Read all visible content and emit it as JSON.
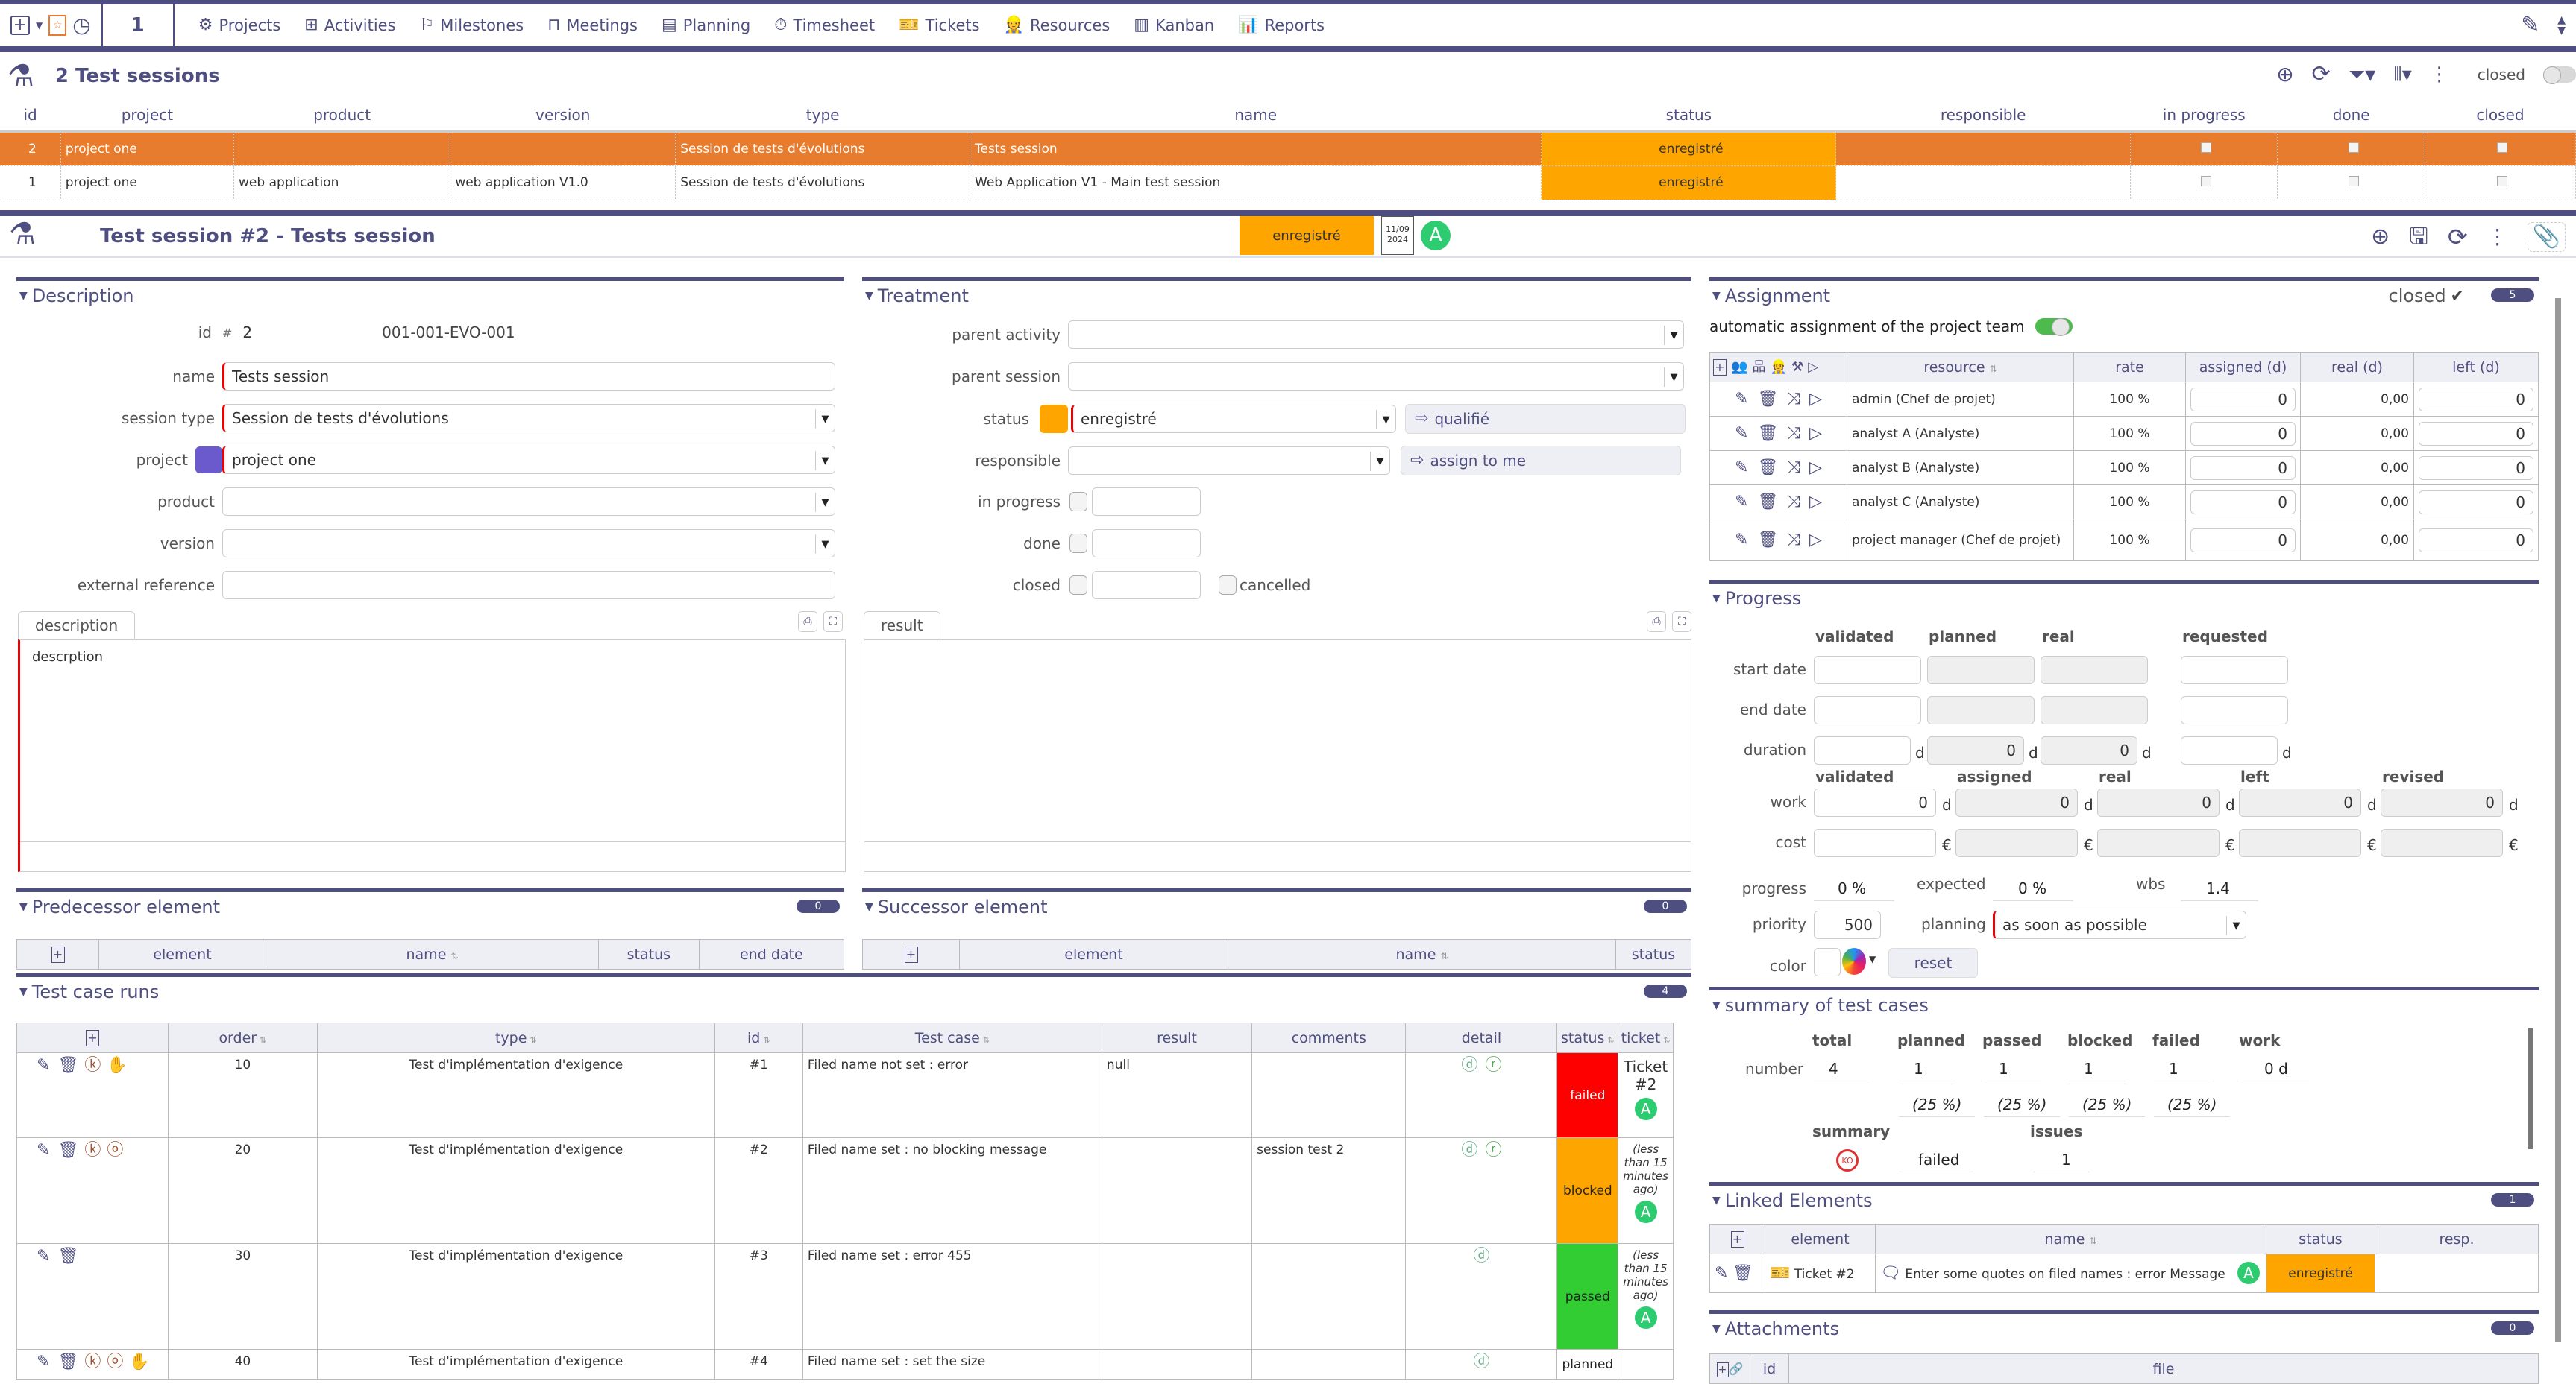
{
  "topbar": {
    "counter": "1",
    "nav": [
      {
        "label": "Projects",
        "icon": "gear-icon"
      },
      {
        "label": "Activities",
        "icon": "activities-icon"
      },
      {
        "label": "Milestones",
        "icon": "flag-icon"
      },
      {
        "label": "Meetings",
        "icon": "meeting-table-icon"
      },
      {
        "label": "Planning",
        "icon": "planning-icon"
      },
      {
        "label": "Timesheet",
        "icon": "stopwatch-icon"
      },
      {
        "label": "Tickets",
        "icon": "ticket-icon"
      },
      {
        "label": "Resources",
        "icon": "worker-icon"
      },
      {
        "label": "Kanban",
        "icon": "kanban-icon"
      },
      {
        "label": "Reports",
        "icon": "chart-icon"
      }
    ]
  },
  "list": {
    "title": "2 Test sessions",
    "closed_label": "closed",
    "columns": [
      "id",
      "project",
      "product",
      "version",
      "type",
      "name",
      "status",
      "responsible",
      "in progress",
      "done",
      "closed"
    ],
    "rows": [
      {
        "id": "2",
        "project": "project one",
        "product": "",
        "version": "",
        "type": "Session de tests d'évolutions",
        "name": "Tests session",
        "status": "enregistré",
        "responsible": "",
        "selected": true
      },
      {
        "id": "1",
        "project": "project one",
        "product": "web application",
        "version": "web application V1.0",
        "type": "Session de tests d'évolutions",
        "name": "Web Application V1 - Main test session",
        "status": "enregistré",
        "responsible": "",
        "selected": false
      }
    ]
  },
  "detail": {
    "title": "Test session  #2  - Tests session",
    "status": "enregistré",
    "calendar_date": "11/09",
    "calendar_year": "2024",
    "avatar": "A"
  },
  "description": {
    "header": "Description",
    "id_label": "id",
    "id_hash": "#",
    "id_value": "2",
    "reference": "001-001-EVO-001",
    "fields": {
      "name": {
        "label": "name",
        "value": "Tests session"
      },
      "session_type": {
        "label": "session type",
        "value": "Session de tests d'évolutions"
      },
      "project": {
        "label": "project",
        "value": "project one"
      },
      "product": {
        "label": "product",
        "value": ""
      },
      "version": {
        "label": "version",
        "value": ""
      },
      "external_reference": {
        "label": "external reference",
        "value": ""
      }
    },
    "tab": "description",
    "text": "descrption"
  },
  "treatment": {
    "header": "Treatment",
    "parent_activity": {
      "label": "parent activity",
      "value": ""
    },
    "parent_session": {
      "label": "parent session",
      "value": ""
    },
    "status": {
      "label": "status",
      "value": "enregistré",
      "action": "qualifié"
    },
    "responsible": {
      "label": "responsible",
      "value": "",
      "action": "assign to me"
    },
    "in_progress": "in progress",
    "done": "done",
    "closed": "closed",
    "cancelled": "cancelled",
    "tab": "result"
  },
  "predecessor": {
    "header": "Predecessor element",
    "count": "0",
    "columns": [
      "element",
      "name",
      "status",
      "end date"
    ]
  },
  "successor": {
    "header": "Successor element",
    "count": "0",
    "columns": [
      "element",
      "name",
      "status"
    ]
  },
  "testcases": {
    "header": "Test case runs",
    "count": "4",
    "columns": [
      "order",
      "type",
      "id",
      "Test case",
      "result",
      "comments",
      "detail",
      "status",
      "ticket"
    ],
    "rows": [
      {
        "order": "10",
        "type": "Test d'implémentation d'exigence",
        "id": "#1",
        "testcase": "Filed name not set : error",
        "result": "null",
        "comments": "",
        "status": "failed",
        "status_color": "#ff0000",
        "ticket": "Ticket #2",
        "avatar": "A"
      },
      {
        "order": "20",
        "type": "Test d'implémentation d'exigence",
        "id": "#2",
        "testcase": "Filed name set : no blocking message",
        "result": "",
        "comments": "session test 2",
        "status": "blocked",
        "status_color": "#ffa500",
        "ticket": "(less than 15 minutes ago)",
        "avatar": "A"
      },
      {
        "order": "30",
        "type": "Test d'implémentation d'exigence",
        "id": "#3",
        "testcase": "Filed name set : error 455",
        "result": "",
        "comments": "",
        "status": "passed",
        "status_color": "#32cd32",
        "ticket": "(less than 15 minutes ago)",
        "avatar": "A"
      },
      {
        "order": "40",
        "type": "Test d'implémentation d'exigence",
        "id": "#4",
        "testcase": "Filed name set : set the size",
        "result": "",
        "comments": "",
        "status": "planned",
        "status_color": "#ffffff",
        "ticket": "",
        "avatar": ""
      }
    ]
  },
  "assignment": {
    "header": "Assignment",
    "closed_label": "closed",
    "count": "5",
    "auto_label": "automatic assignment of the project team",
    "columns": [
      "resource",
      "rate",
      "assigned (d)",
      "real (d)",
      "left (d)"
    ],
    "rows": [
      {
        "resource": "admin (Chef de projet)",
        "rate": "100 %",
        "assigned": "0",
        "real": "0,00",
        "left": "0"
      },
      {
        "resource": "analyst A (Analyste)",
        "rate": "100 %",
        "assigned": "0",
        "real": "0,00",
        "left": "0"
      },
      {
        "resource": "analyst B (Analyste)",
        "rate": "100 %",
        "assigned": "0",
        "real": "0,00",
        "left": "0"
      },
      {
        "resource": "analyst C (Analyste)",
        "rate": "100 %",
        "assigned": "0",
        "real": "0,00",
        "left": "0"
      },
      {
        "resource": "project manager (Chef de projet)",
        "rate": "100 %",
        "assigned": "0",
        "real": "0,00",
        "left": "0"
      }
    ]
  },
  "progress": {
    "header": "Progress",
    "date_cols": [
      "validated",
      "planned",
      "real",
      "requested"
    ],
    "start_date": "start date",
    "end_date": "end date",
    "duration": "duration",
    "duration_values": [
      "",
      "0",
      "0",
      ""
    ],
    "unit_d": "d",
    "work_cols": [
      "validated",
      "assigned",
      "real",
      "left",
      "revised"
    ],
    "work": "work",
    "work_values": [
      "0",
      "0",
      "0",
      "0",
      "0"
    ],
    "cost": "cost",
    "currency": "€",
    "progress_label": "progress",
    "progress_value": "0 %",
    "expected_label": "expected",
    "expected_value": "0 %",
    "wbs_label": "wbs",
    "wbs_value": "1.4",
    "priority_label": "priority",
    "priority_value": "500",
    "planning_label": "planning",
    "planning_value": "as soon as possible",
    "color_label": "color",
    "reset": "reset"
  },
  "summary": {
    "header": "summary of test cases",
    "cols": [
      "total",
      "planned",
      "passed",
      "blocked",
      "failed",
      "work"
    ],
    "number_label": "number",
    "numbers": [
      "4",
      "1",
      "1",
      "1",
      "1",
      "0 d"
    ],
    "percents": [
      "(25 %)",
      "(25 %)",
      "(25 %)",
      "(25 %)"
    ],
    "summary_label": "summary",
    "summary_value": "failed",
    "issues_label": "issues",
    "issues_value": "1"
  },
  "linked": {
    "header": "Linked Elements",
    "count": "1",
    "columns": [
      "element",
      "name",
      "status",
      "resp."
    ],
    "rows": [
      {
        "element": "Ticket #2",
        "name": "Enter some quotes on filed names : error Message",
        "avatar": "A",
        "status": "enregistré"
      }
    ]
  },
  "attachments": {
    "header": "Attachments",
    "count": "0",
    "columns": [
      "id",
      "file"
    ]
  }
}
